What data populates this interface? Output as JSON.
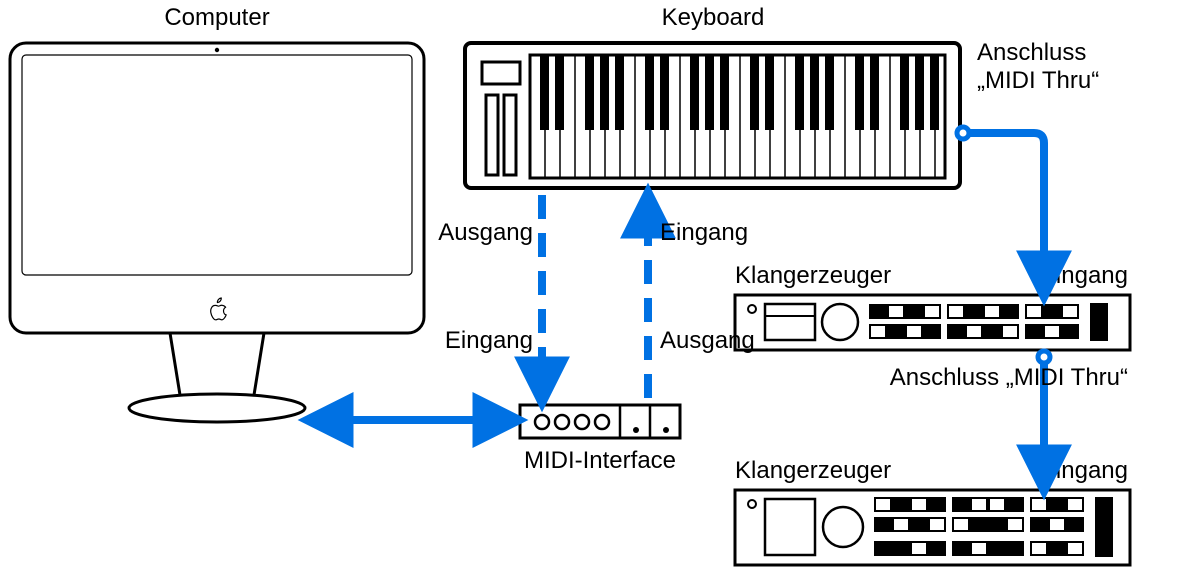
{
  "labels": {
    "computer": "Computer",
    "keyboard": "Keyboard",
    "midi_interface": "MIDI-Interface",
    "ausgang1": "Ausgang",
    "eingang1": "Eingang",
    "eingang2": "Eingang",
    "ausgang2": "Ausgang",
    "midi_thru1": "Anschluss\n„MIDI Thru“",
    "klang1": "Klangerzeuger",
    "klang1_in": "Eingang",
    "midi_thru2": "Anschluss „MIDI Thru“",
    "klang2": "Klangerzeuger",
    "klang2_in": "Eingang"
  },
  "colors": {
    "stroke": "#000000",
    "arrow": "#0071e3"
  }
}
